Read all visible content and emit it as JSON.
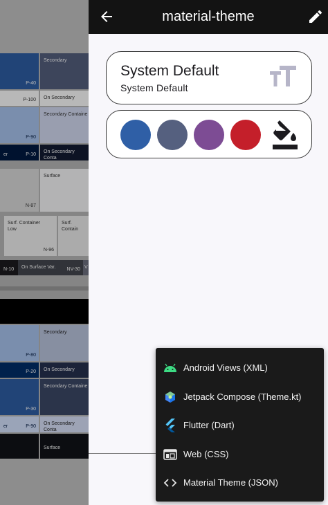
{
  "appbar": {
    "title": "material-theme",
    "back_icon": "arrow-back-icon",
    "edit_icon": "edit-pencil-icon"
  },
  "font_card": {
    "title": "System Default",
    "subtitle": "System Default",
    "icon": "text-size-icon"
  },
  "color_card": {
    "swatches": [
      "#2f5fa6",
      "#55607f",
      "#7d4c94",
      "#c41f2a"
    ],
    "icon": "format-color-fill-icon"
  },
  "export_menu": {
    "items": [
      {
        "label": "Android Views (XML)",
        "icon": "android-icon"
      },
      {
        "label": "Jetpack Compose (Theme.kt)",
        "icon": "jetpack-compose-icon"
      },
      {
        "label": "Flutter (Dart)",
        "icon": "flutter-icon"
      },
      {
        "label": "Web (CSS)",
        "icon": "web-icon"
      },
      {
        "label": "Material Theme (JSON)",
        "icon": "code-icon"
      }
    ]
  },
  "background_palette": {
    "light": {
      "secondary": "Secondary",
      "p40": "P-40",
      "p100": "P-100",
      "on_secondary": "On Secondary",
      "p90": "P-90",
      "secondary_container": "Secondary Containe",
      "p10": "P-10",
      "er": "er",
      "on_secondary_cont": "On Secondary Conta",
      "surface": "Surface",
      "n87": "N-87",
      "surf_container_low": "Surf. Container Low",
      "surf_container": "Surf. Contain",
      "n96": "N-96",
      "n10": "N-10",
      "on_surface_var": "On Surface Var.",
      "nv30": "NV-30",
      "v": "V"
    },
    "dark": {
      "secondary": "Secondary",
      "p80": "P-80",
      "p20": "P-20",
      "on_secondary": "On Secondary",
      "secondary_container": "Secondary Containe",
      "p30": "P-30",
      "er": "er",
      "p90": "P-90",
      "on_secondary_cont": "On Secondary Conta",
      "surface": "Surface"
    }
  }
}
